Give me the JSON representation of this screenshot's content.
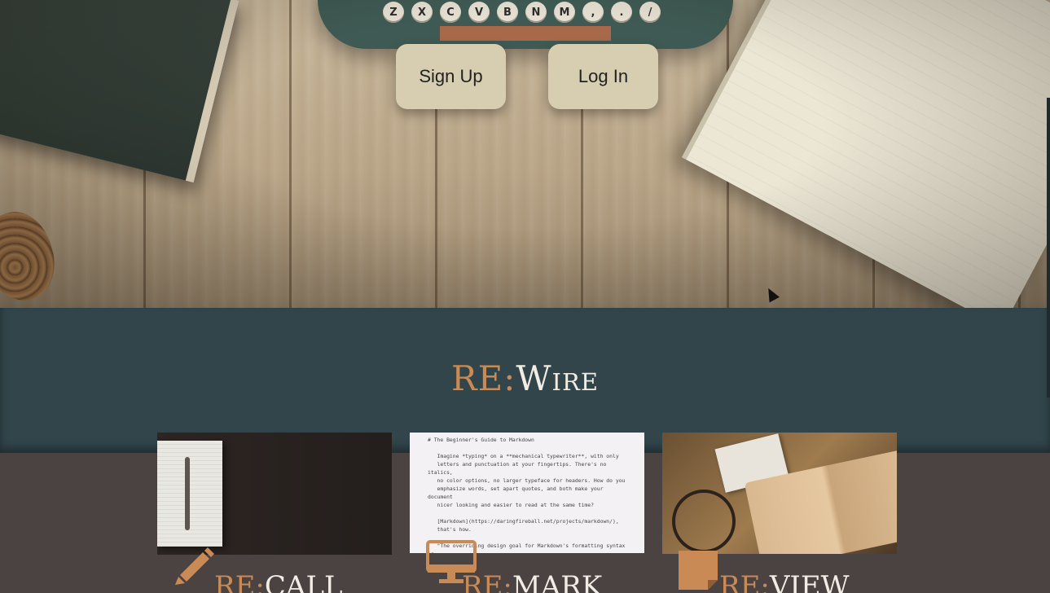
{
  "hero": {
    "signup_label": "Sign Up",
    "login_label": "Log In",
    "typewriter_keys": [
      "Z",
      "X",
      "C",
      "V",
      "B",
      "N",
      "M",
      ",",
      ".",
      "/"
    ]
  },
  "brand": {
    "prefix": "RE:",
    "name": "Wire"
  },
  "features": [
    {
      "prefix": "RE:",
      "name": "CALL",
      "icon": "pencil-icon"
    },
    {
      "prefix": "RE:",
      "name": "MARK",
      "icon": "monitor-icon"
    },
    {
      "prefix": "RE:",
      "name": "VIEW",
      "icon": "sticky-note-icon"
    }
  ],
  "doc_preview": {
    "text": "# The Beginner's Guide to Markdown\n\n   Imagine *typing* on a **mechanical typewriter**, with only\n   letters and punctuation at your fingertips. There's no italics,\n   no color options, no larger typeface for headers. How do you\n   emphasize words, set apart quotes, and both make your document\n   nicer looking and easier to read at the same time?\n\n   [Markdown](https://daringfireball.net/projects/markdown/),\n   that's how.\n\n   \"The overriding design goal for Markdown's formatting syntax is\n   to make it as readable as possible.\" - John Gruber"
  },
  "colors": {
    "accent": "#c98a55",
    "band": "#31454b",
    "lower_bg": "#4a4342",
    "button_bg": "#d7cdb0"
  }
}
